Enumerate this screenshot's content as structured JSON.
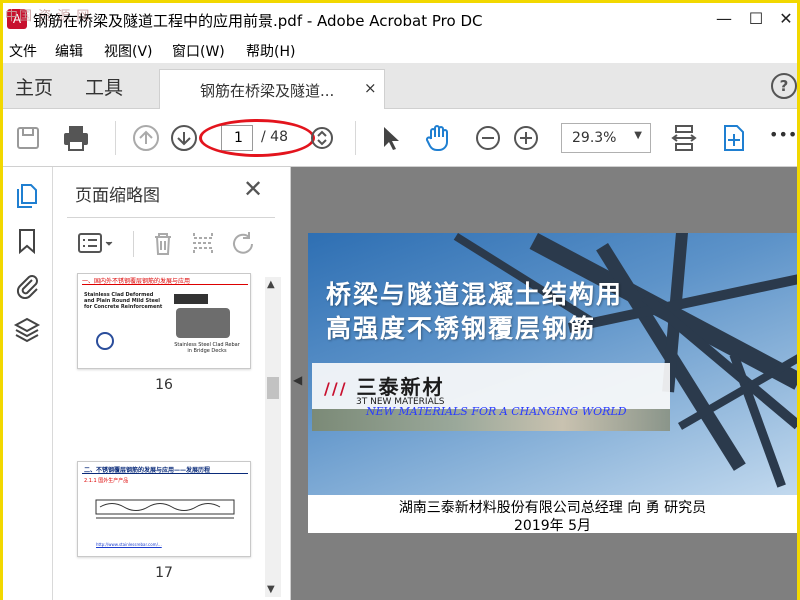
{
  "window": {
    "title": "钢筋在桥梁及隧道工程中的应用前景.pdf - Adobe Acrobat Pro DC",
    "watermark": "中国 资 源 网",
    "minimize": "—",
    "maximize": "☐",
    "close": "✕"
  },
  "menu": [
    "文件",
    "编辑",
    "视图(V)",
    "窗口(W)",
    "帮助(H)"
  ],
  "tabs": {
    "home": "主页",
    "tools": "工具",
    "document": "钢筋在桥梁及隧道...",
    "close": "×",
    "help": "?"
  },
  "toolbar": {
    "page_current": "1",
    "page_total": "/ 48",
    "zoom": "29.3%",
    "more": "•••"
  },
  "panel": {
    "title": "页面缩略图",
    "close": "✕",
    "thumbnails": [
      {
        "label": "16",
        "heading": "一、国内外不锈钢覆层钢筋的发展与应用",
        "doc_title": "Stainless Clad Deformed and Plain Round Mild Steel for Concrete Reinforcement",
        "caption": "Stainless Steel Clad Rebar in Bridge Decks"
      },
      {
        "label": "17",
        "heading": "二、不锈钢覆层钢筋的发展与应用——发展历程",
        "subheading": "2.1.1 国外生产产品",
        "link": "http://www.stainlessrebar.com/..."
      }
    ]
  },
  "slide": {
    "title_line1": "桥梁与隧道混凝土结构用",
    "title_line2": "高强度不锈钢覆层钢筋",
    "logo_cn": "三泰新材",
    "logo_en": "3T NEW MATERIALS",
    "slogan": "NEW MATERIALS FOR A CHANGING WORLD",
    "footer_line1": "湖南三泰新材料股份有限公司总经理  向 勇  研究员",
    "footer_line2": "2019年  5月"
  },
  "colors": {
    "annotation": "#e3141d",
    "accent_blue": "#1f7fd1",
    "frame": "#f2d800"
  }
}
